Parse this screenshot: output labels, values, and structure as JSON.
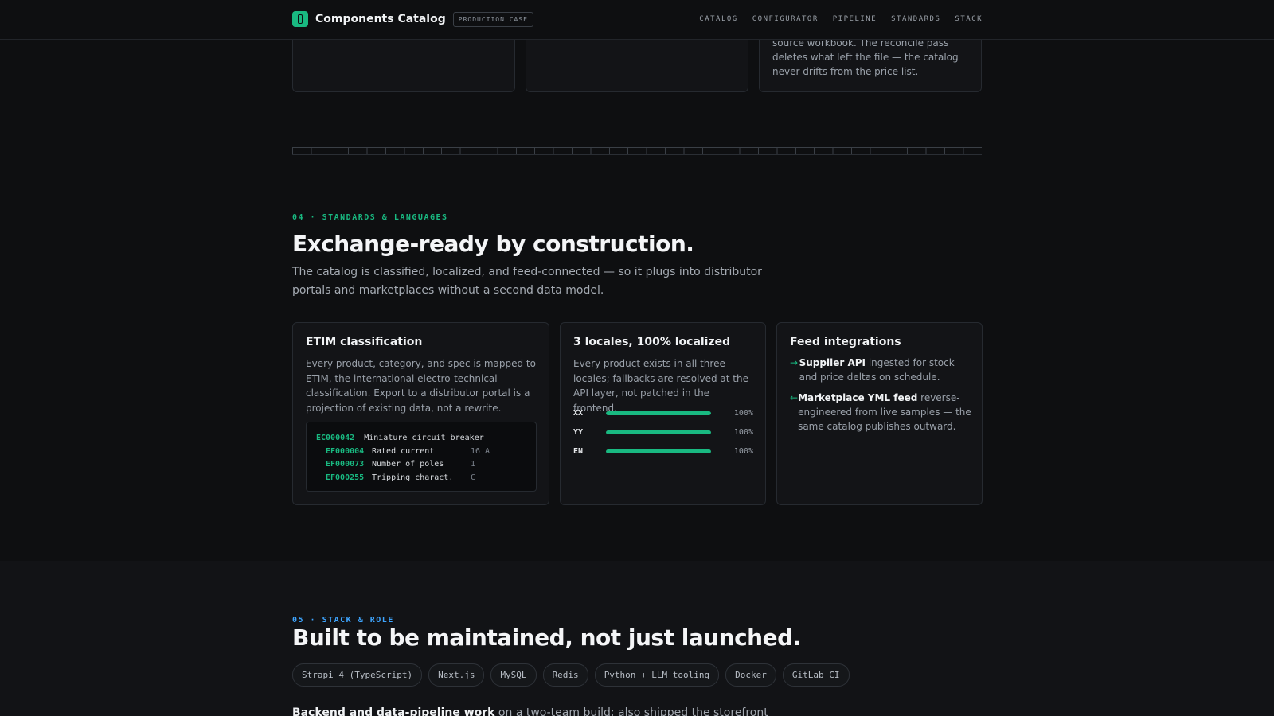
{
  "header": {
    "brand": "Components Catalog",
    "badge": "PRODUCTION CASE",
    "nav": [
      "CATALOG",
      "CONFIGURATOR",
      "PIPELINE",
      "STANDARDS",
      "STACK"
    ]
  },
  "top_cards": {
    "third_text": "source workbook. The reconcile pass deletes what left the file — the catalog never drifts from the price list."
  },
  "standards": {
    "eyebrow": "04 · STANDARDS & LANGUAGES",
    "title": "Exchange-ready by construction.",
    "lede": "The catalog is classified, localized, and feed-connected — so it plugs into distributor portals and marketplaces without a second data model.",
    "etim": {
      "title": "ETIM classification",
      "body": "Every product, category, and spec is mapped to ETIM, the international electro-technical classification. Export to a distributor portal is a projection of existing data, not a rewrite.",
      "class_code": "EC000042",
      "class_label": "Miniature circuit breaker",
      "features": [
        {
          "code": "EF000004",
          "label": "Rated current",
          "value": "16 A"
        },
        {
          "code": "EF000073",
          "label": "Number of poles",
          "value": "1"
        },
        {
          "code": "EF000255",
          "label": "Tripping charact.",
          "value": "C"
        }
      ]
    },
    "locales": {
      "title": "3 locales, 100% localized",
      "body": "Every product exists in all three locales; fallbacks are resolved at the API layer, not patched in the frontend.",
      "items": [
        {
          "code": "XX",
          "percent": 100,
          "label": "100%"
        },
        {
          "code": "YY",
          "percent": 100,
          "label": "100%"
        },
        {
          "code": "EN",
          "percent": 100,
          "label": "100%"
        }
      ]
    },
    "feeds": {
      "title": "Feed integrations",
      "items": [
        {
          "icon": "arrow-right-icon",
          "name": "Supplier API",
          "text": " ingested for stock and price deltas on schedule."
        },
        {
          "icon": "arrow-left-icon",
          "name": "Marketplace YML feed",
          "text": " reverse-engineered from live samples — the same catalog publishes outward."
        }
      ]
    }
  },
  "stack": {
    "eyebrow": "05 · STACK & ROLE",
    "title": "Built to be maintained, not just launched.",
    "chips": [
      "Strapi 4 (TypeScript)",
      "Next.js",
      "MySQL",
      "Redis",
      "Python + LLM tooling",
      "Docker",
      "GitLab CI"
    ],
    "role_bold": "Backend and data-pipeline work",
    "role_text": " on a two-team build; also shipped the storefront"
  },
  "colors": {
    "accent": "#19b981",
    "accent_blue": "#3ea5ff",
    "background": "#0e0f11"
  }
}
